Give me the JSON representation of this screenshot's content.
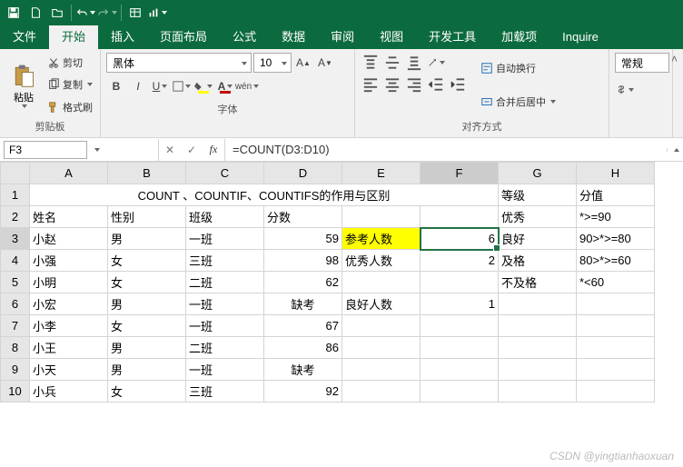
{
  "qat": {
    "save": "save-icon",
    "new": "new-icon",
    "open": "open-icon",
    "undo": "undo-icon",
    "redo": "redo-icon",
    "chart": "chart-icon"
  },
  "menu": {
    "items": [
      "文件",
      "开始",
      "插入",
      "页面布局",
      "公式",
      "数据",
      "审阅",
      "视图",
      "开发工具",
      "加载项",
      "Inquire"
    ],
    "active": 1
  },
  "ribbon": {
    "clipboard": {
      "paste": "粘贴",
      "cut": "剪切",
      "copy": "复制",
      "format_painter": "格式刷",
      "label": "剪贴板"
    },
    "font": {
      "name": "黑体",
      "size": "10",
      "label": "字体"
    },
    "align": {
      "wrap": "自动换行",
      "merge": "合并后居中",
      "label": "对齐方式"
    },
    "number": {
      "general": "常规"
    }
  },
  "namebox": {
    "ref": "F3"
  },
  "formula": {
    "value": "=COUNT(D3:D10)"
  },
  "chart_data": {
    "type": "table",
    "title": "COUNT 、COUNTIF、COUNTIFS的作用与区别",
    "headers_main": [
      "姓名",
      "性别",
      "班级",
      "分数"
    ],
    "rows_main": [
      {
        "name": "小赵",
        "gender": "男",
        "class": "一班",
        "score": 59
      },
      {
        "name": "小强",
        "gender": "女",
        "class": "三班",
        "score": 98
      },
      {
        "name": "小明",
        "gender": "女",
        "class": "二班",
        "score": 62
      },
      {
        "name": "小宏",
        "gender": "男",
        "class": "一班",
        "score": "缺考"
      },
      {
        "name": "小李",
        "gender": "女",
        "class": "一班",
        "score": 67
      },
      {
        "name": "小王",
        "gender": "男",
        "class": "二班",
        "score": 86
      },
      {
        "name": "小天",
        "gender": "男",
        "class": "一班",
        "score": "缺考"
      },
      {
        "name": "小兵",
        "gender": "女",
        "class": "三班",
        "score": 92
      }
    ],
    "stats": [
      {
        "label": "参考人数",
        "value": 6
      },
      {
        "label": "优秀人数",
        "value": 2
      },
      {
        "label": "良好人数",
        "value": 1
      }
    ],
    "grades": {
      "header_level": "等级",
      "header_value": "分值",
      "rows": [
        {
          "level": "优秀",
          "value": "*>=90"
        },
        {
          "level": "良好",
          "value": "90>*>=80"
        },
        {
          "level": "及格",
          "value": "80>*>=60"
        },
        {
          "level": "不及格",
          "value": "*<60"
        }
      ]
    }
  },
  "columns": [
    "A",
    "B",
    "C",
    "D",
    "E",
    "F",
    "G",
    "H"
  ],
  "row_numbers": [
    1,
    2,
    3,
    4,
    5,
    6,
    7,
    8,
    9,
    10
  ],
  "watermark": "CSDN @yingtianhaoxuan"
}
